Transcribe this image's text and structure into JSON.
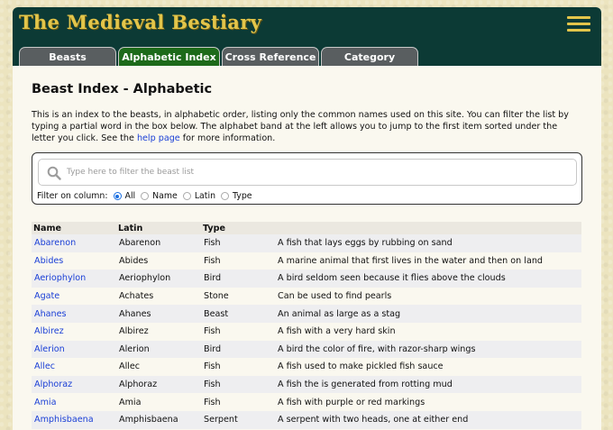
{
  "header": {
    "site_title": "The Medieval Bestiary",
    "menu_icon": "hamburger-menu-icon"
  },
  "tabs": [
    {
      "label": "Beasts",
      "active": false
    },
    {
      "label": "Alphabetic Index",
      "active": true
    },
    {
      "label": "Cross Reference",
      "active": false
    },
    {
      "label": "Category",
      "active": false
    }
  ],
  "page": {
    "heading": "Beast Index - Alphabetic",
    "intro_before_link": "This is an index to the beasts, in alphabetic order, listing only the common names used on this site. You can filter the list by typing a partial word in the box below. The alphabet band at the left allows you to jump to the first item sorted under the letter you click. See the ",
    "intro_link": "help page",
    "intro_after_link": " for more information."
  },
  "filter": {
    "placeholder": "Type here to filter the beast list",
    "value": "",
    "column_label": "Filter on column:",
    "options": [
      "All",
      "Name",
      "Latin",
      "Type"
    ],
    "selected": "All"
  },
  "table": {
    "columns": [
      "Name",
      "Latin",
      "Type",
      ""
    ],
    "rows": [
      {
        "name": "Abarenon",
        "latin": "Abarenon",
        "type": "Fish",
        "desc": "A fish that lays eggs by rubbing on sand"
      },
      {
        "name": "Abides",
        "latin": "Abides",
        "type": "Fish",
        "desc": "A marine animal that first lives in the water and then on land"
      },
      {
        "name": "Aeriophylon",
        "latin": "Aeriophylon",
        "type": "Bird",
        "desc": "A bird seldom seen because it flies above the clouds"
      },
      {
        "name": "Agate",
        "latin": "Achates",
        "type": "Stone",
        "desc": "Can be used to find pearls"
      },
      {
        "name": "Ahanes",
        "latin": "Ahanes",
        "type": "Beast",
        "desc": "An animal as large as a stag"
      },
      {
        "name": "Albirez",
        "latin": "Albirez",
        "type": "Fish",
        "desc": "A fish with a very hard skin"
      },
      {
        "name": "Alerion",
        "latin": "Alerion",
        "type": "Bird",
        "desc": "A bird the color of fire, with razor-sharp wings"
      },
      {
        "name": "Allec",
        "latin": "Allec",
        "type": "Fish",
        "desc": "A fish used to make pickled fish sauce"
      },
      {
        "name": "Alphoraz",
        "latin": "Alphoraz",
        "type": "Fish",
        "desc": "A fish the is generated from rotting mud"
      },
      {
        "name": "Amia",
        "latin": "Amia",
        "type": "Fish",
        "desc": "A fish with purple or red markings"
      },
      {
        "name": "Amphisbaena",
        "latin": "Amphisbaena",
        "type": "Serpent",
        "desc": "A serpent with two heads, one at either end"
      }
    ]
  }
}
